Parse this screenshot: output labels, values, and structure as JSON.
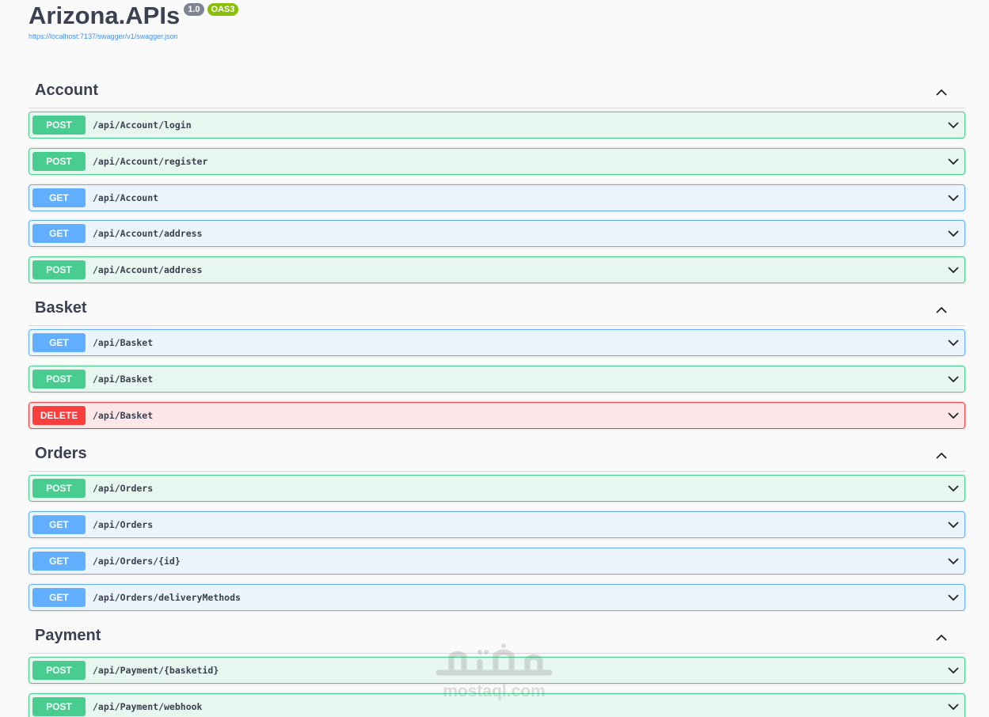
{
  "info": {
    "title": "Arizona.APIs",
    "version": "1.0",
    "oas": "OAS3",
    "url": "https://localhost:7137/swagger/v1/swagger.json"
  },
  "colors": {
    "post": "#49cc90",
    "get": "#61affe",
    "delete": "#f93e3e"
  },
  "sections": [
    {
      "name": "Account",
      "operations": [
        {
          "method": "POST",
          "path": "/api/Account/login"
        },
        {
          "method": "POST",
          "path": "/api/Account/register"
        },
        {
          "method": "GET",
          "path": "/api/Account"
        },
        {
          "method": "GET",
          "path": "/api/Account/address"
        },
        {
          "method": "POST",
          "path": "/api/Account/address"
        }
      ]
    },
    {
      "name": "Basket",
      "operations": [
        {
          "method": "GET",
          "path": "/api/Basket"
        },
        {
          "method": "POST",
          "path": "/api/Basket"
        },
        {
          "method": "DELETE",
          "path": "/api/Basket"
        }
      ]
    },
    {
      "name": "Orders",
      "operations": [
        {
          "method": "POST",
          "path": "/api/Orders"
        },
        {
          "method": "GET",
          "path": "/api/Orders"
        },
        {
          "method": "GET",
          "path": "/api/Orders/{id}"
        },
        {
          "method": "GET",
          "path": "/api/Orders/deliveryMethods"
        }
      ]
    },
    {
      "name": "Payment",
      "operations": [
        {
          "method": "POST",
          "path": "/api/Payment/{basketid}"
        },
        {
          "method": "POST",
          "path": "/api/Payment/webhook"
        }
      ]
    }
  ],
  "watermark": {
    "script": "مستقل",
    "text": "mostaql.com"
  }
}
